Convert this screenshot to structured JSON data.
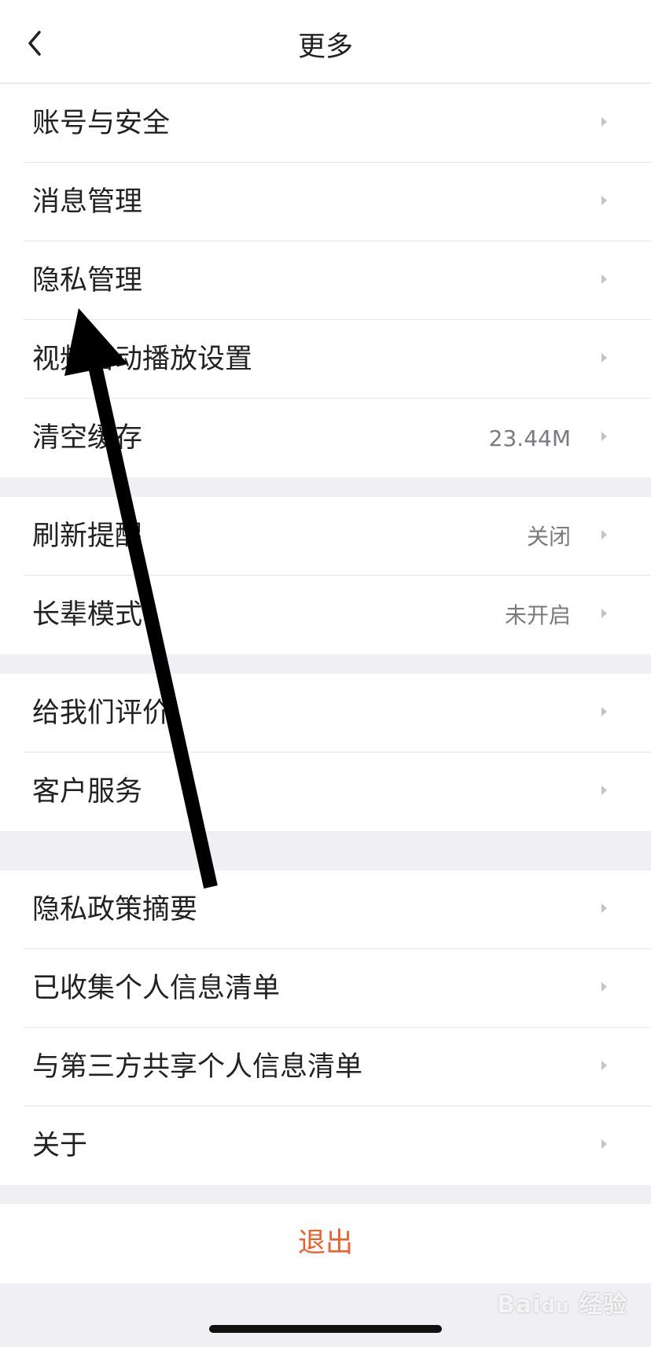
{
  "header": {
    "title": "更多",
    "back_icon": "chevron-left-icon"
  },
  "groups": [
    {
      "rows": [
        {
          "label": "账号与安全",
          "value": ""
        },
        {
          "label": "消息管理",
          "value": ""
        },
        {
          "label": "隐私管理",
          "value": ""
        },
        {
          "label": "视频自动播放设置",
          "value": ""
        },
        {
          "label": "清空缓存",
          "value": "23.44M"
        }
      ]
    },
    {
      "rows": [
        {
          "label": "刷新提醒",
          "value": "关闭"
        },
        {
          "label": "长辈模式",
          "value": "未开启"
        }
      ]
    },
    {
      "rows": [
        {
          "label": "给我们评价",
          "value": ""
        },
        {
          "label": "客户服务",
          "value": ""
        }
      ]
    },
    {
      "rows": [
        {
          "label": "隐私政策摘要",
          "value": ""
        },
        {
          "label": "已收集个人信息清单",
          "value": ""
        },
        {
          "label": "与第三方共享个人信息清单",
          "value": ""
        },
        {
          "label": "关于",
          "value": ""
        }
      ]
    }
  ],
  "logout": {
    "label": "退出",
    "color": "#f0602e"
  },
  "watermark": {
    "text": "Bai du 经验",
    "sub": "jingyan.baidu.com"
  },
  "colors": {
    "background": "#f0eff4",
    "row_text": "#222222",
    "value_text": "#7a7a80",
    "chevron": "#c4c4c8",
    "annotation_arrow": "#000000"
  }
}
